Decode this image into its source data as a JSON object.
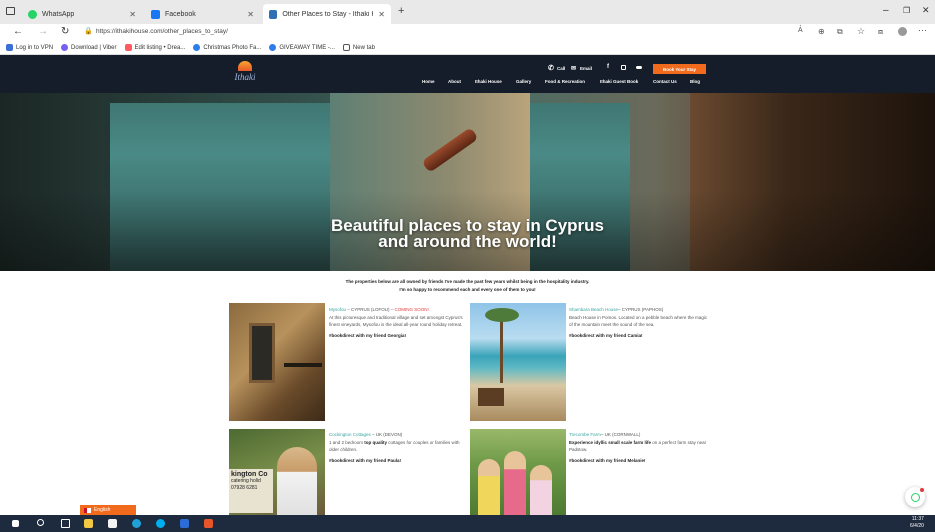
{
  "browser": {
    "tabs": [
      {
        "label": "WhatsApp",
        "active": false
      },
      {
        "label": "Facebook",
        "active": false
      },
      {
        "label": "Other Places to Stay - Ithaki Ho",
        "active": true
      }
    ],
    "new_tab": "+",
    "url": "https://ithakihouse.com/other_places_to_stay/",
    "bookmarks": [
      "Log in to VPN",
      "Download | Viber",
      "Edit listing • Drea...",
      "Christmas Photo Fa...",
      "GIVEAWAY TIME -...",
      "New tab"
    ]
  },
  "site": {
    "logo_text": "Ithaki",
    "top_links": {
      "call": "Call",
      "email": "Email",
      "facebook": "f"
    },
    "book_button": "Book Your Stay",
    "nav": [
      "Home",
      "About",
      "Ithaki House",
      "Gallery",
      "Food & Recreation",
      "Ithaki Guest Book",
      "Contact Us",
      "Blog"
    ]
  },
  "hero": {
    "line1": "Beautiful places to stay in Cyprus",
    "line2": "and around the world!"
  },
  "intro": {
    "line1": "The properties below are all owned by friends I've made the past few years whilst being in the hospitality industry.",
    "line2": "I'm so happy to recommend each and every one of them to you!"
  },
  "properties": [
    {
      "name": "Mysofou",
      "location": " – CYPRUS (LOFOU) – ",
      "status": "COMING SOON!",
      "desc": "At this picturesque and traditional village and set amongst Cyprus's finest vineyards, Mysofou is the ideal all-year round holiday retreat.",
      "friend": "#bookdirect with my friend Georgia!"
    },
    {
      "name": "Shambara Beach House",
      "location": "– CYPRUS (PAPHOS)",
      "desc": "Beach House in Pomos. Located on a pebble beach where the magic of the mountain meet the sound of the sea.",
      "friend": "#bookdirect with my friend Camia!"
    },
    {
      "name": "Cockington Cottages",
      "location": " – UK (DEVON)",
      "desc_pre": "1 and 2 bedroom ",
      "desc_bold": "top quality",
      "desc_post": " cottages for couples or families with older children.",
      "friend": "#bookdirect with my friend Paula!"
    },
    {
      "name": "Trecombe Farm",
      "location": "– UK (CORNWALL)",
      "desc_bold": "Experience idyllic small scale farm life",
      "desc_post": " on a perfect farm stay near Padstow.",
      "friend": "#bookdirect with my friend Melanie!"
    }
  ],
  "sign_text": {
    "line1": "kington Co",
    "line2": "catering holid",
    "line3": "07928 6281"
  },
  "language": "English",
  "taskbar": {
    "time": "11:37",
    "date": "6/4/20"
  }
}
